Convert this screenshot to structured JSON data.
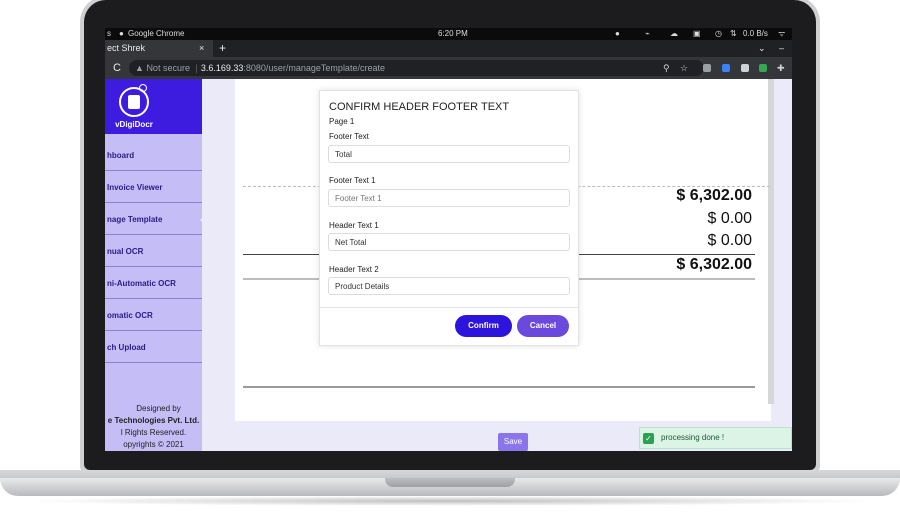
{
  "status": {
    "left": "s",
    "app": "Google Chrome",
    "time": "6:20 PM",
    "net": "0.0 B/s"
  },
  "tab": {
    "title": "ect Shrek",
    "close": "×",
    "new": "+"
  },
  "address": {
    "security": "Not secure",
    "host": "3.6.169.33",
    "path": ":8080/user/manageTemplate/create"
  },
  "sidebar": {
    "logo_text": "vDigiDocr",
    "items": [
      {
        "label": "hboard"
      },
      {
        "label": "Invoice Viewer"
      },
      {
        "label": "nage Template"
      },
      {
        "label": "nual OCR"
      },
      {
        "label": "ni-Automatic OCR"
      },
      {
        "label": "omatic OCR"
      },
      {
        "label": "ch Upload"
      }
    ],
    "footer": [
      "Designed by",
      "e Technologies Pvt. Ltd.",
      "l Rights Reserved.",
      "opyrights © 2021"
    ]
  },
  "invoice": {
    "total1": "$ 6,302.00",
    "line2": "$ 0.00",
    "line3": "$ 0.00",
    "total2": "$ 6,302.00"
  },
  "modal": {
    "title": "CONFIRM HEADER FOOTER TEXT",
    "page": "Page 1",
    "fields": [
      {
        "label": "Footer Text",
        "value": "Total",
        "placeholder": ""
      },
      {
        "label": "Footer Text 1",
        "value": "",
        "placeholder": "Footer Text 1"
      },
      {
        "label": "Header Text 1",
        "value": "Net Total",
        "placeholder": ""
      },
      {
        "label": "Header Text 2",
        "value": "Product Details",
        "placeholder": ""
      }
    ],
    "confirm": "Confirm",
    "cancel": "Cancel"
  },
  "save_label": "Save",
  "toast": {
    "text": "processing done !",
    "color": "#2aa152"
  }
}
